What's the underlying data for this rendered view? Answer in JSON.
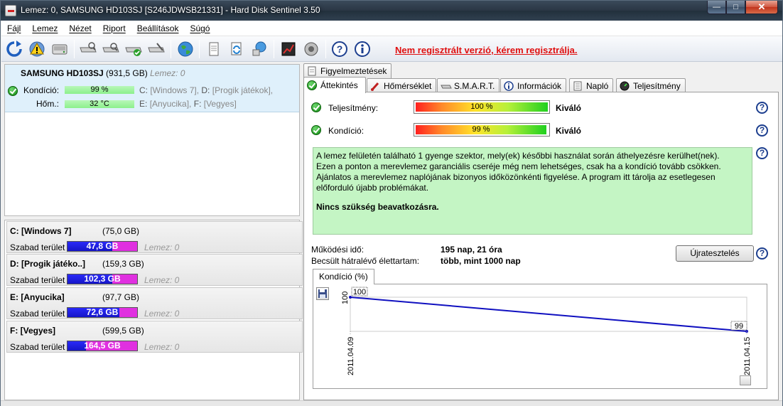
{
  "window": {
    "title": "Lemez: 0, SAMSUNG HD103SJ [S246JDWSB21331]  -  Hard Disk Sentinel 3.50",
    "controls": {
      "minimize": "—",
      "maximize": "□",
      "close": "✕"
    }
  },
  "menu": [
    "Fájl",
    "Lemez",
    "Nézet",
    "Riport",
    "Beállítások",
    "Súgó"
  ],
  "toolbar": {
    "icons": [
      "refresh-icon",
      "alert-icon",
      "disk-icon",
      "disk-test-icon",
      "disk-test2-icon",
      "disk-check-icon",
      "disk-config-icon",
      "globe-icon",
      "report-icon",
      "sync-icon",
      "network-icon",
      "chart-icon",
      "speaker-icon",
      "help-icon",
      "info-icon"
    ],
    "register_link": "Nem regisztrált verzió, kérem regisztrálja."
  },
  "disk": {
    "name": "SAMSUNG HD103SJ",
    "size": "(931,5 GB)",
    "lemez": "Lemez: 0",
    "health_label": "Kondíció:",
    "health_value": "99 %",
    "temp_label": "Hőm.:",
    "temp_value": "32 °C",
    "partitions_line1_a": "C:",
    "partitions_line1_b": "[Windows 7],",
    "partitions_line1_c": "D:",
    "partitions_line1_d": "[Progik játékok],",
    "partitions_line2_a": "E:",
    "partitions_line2_b": "[Anyucika],",
    "partitions_line2_c": "F:",
    "partitions_line2_d": "[Vegyes]"
  },
  "partitions": [
    {
      "name": "C: [Windows 7]",
      "size": "(75,0 GB)",
      "free_label": "Szabad terület",
      "free": "47,8 GB",
      "free_fraction": 0.64,
      "lemez": "Lemez: 0"
    },
    {
      "name": "D: [Progik játéko..]",
      "size": "(159,3 GB)",
      "free_label": "Szabad terület",
      "free": "102,3 GB",
      "free_fraction": 0.64,
      "lemez": "Lemez: 0"
    },
    {
      "name": "E: [Anyucika]",
      "size": "(97,7 GB)",
      "free_label": "Szabad terület",
      "free": "72,6 GB",
      "free_fraction": 0.74,
      "lemez": "Lemez: 0"
    },
    {
      "name": "F: [Vegyes]",
      "size": "(599,5 GB)",
      "free_label": "Szabad terület",
      "free": "164,5 GB",
      "free_fraction": 0.27,
      "lemez": "Lemez: 0"
    }
  ],
  "tabs": {
    "warnings": "Figyelmeztetések",
    "overview": "Áttekintés",
    "temperature": "Hőmérséklet",
    "smart": "S.M.A.R.T.",
    "info": "Információk",
    "log": "Napló",
    "performance": "Teljesítmény"
  },
  "overview": {
    "performance_label": "Teljesítmény:",
    "performance_value": "100 %",
    "performance_fraction": 1.0,
    "performance_quality": "Kiváló",
    "health_label": "Kondíció:",
    "health_value": "99 %",
    "health_fraction": 0.99,
    "health_quality": "Kiváló",
    "message": "A lemez felületén található 1 gyenge szektor, mely(ek) későbbi használat során áthelyezésre kerülhet(nek).\nEzen a ponton a merevlemez garanciális cseréje még nem lehetséges, csak ha a kondíció tovább csökken.\nAjánlatos a merevlemez naplójának bizonyos időközönkénti figyelése. A program itt tárolja az esetlegesen\nelőforduló újabb problémákat.",
    "message_action": "Nincs szükség beavatkozásra.",
    "uptime_label": "Működési idő:",
    "uptime_value": "195 nap, 21 óra",
    "lifetime_label": "Becsült hátralévő élettartam:",
    "lifetime_value": "több, mint 1000 nap",
    "retest_button": "Újratesztelés",
    "help_glyph": "?",
    "chart_tab": "Kondíció  (%)"
  },
  "chart_data": {
    "type": "line",
    "x": [
      "2011.04.09",
      "2011.04.15"
    ],
    "values": [
      100,
      99
    ],
    "ylim": [
      99,
      100
    ],
    "y_tick_left": "100",
    "labels": [
      "100",
      "99"
    ],
    "line_color": "#1010c0",
    "grid": false
  },
  "colors": {
    "register_link": "#e01010",
    "free_space_blue": "#2020ff",
    "free_space_magenta": "#e030e0",
    "message_bg": "#c4f5c4"
  }
}
